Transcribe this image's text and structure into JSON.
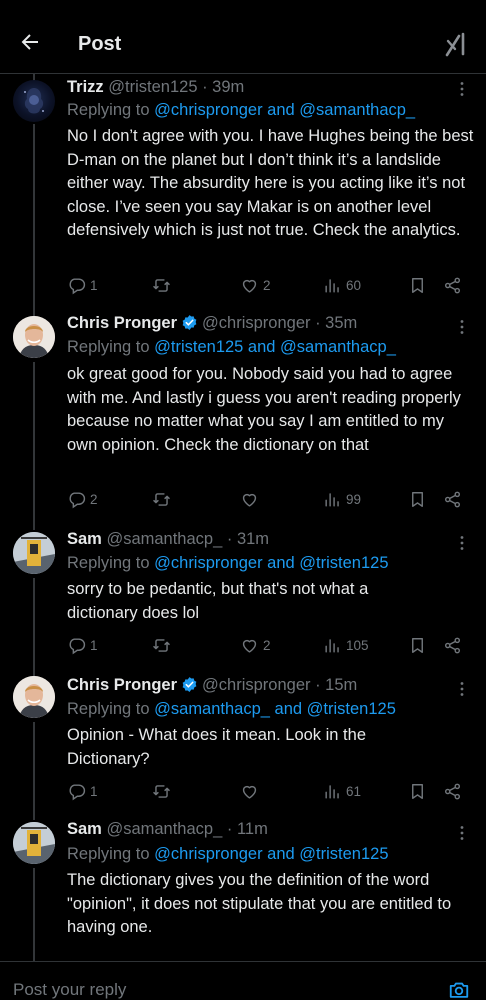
{
  "header": {
    "title": "Post"
  },
  "tweets": [
    {
      "name": "Trizz",
      "handle": "@tristen125",
      "time": "· 39m",
      "verified": false,
      "reply_prefix": "Replying to ",
      "reply_targets": "@chrispronger and @samanthacp_",
      "text": "No I don’t agree with you. I have Hughes being the best D-man on the planet but I don’t think it’s a landslide either way. The absurdity here is you acting like it’s not close. I’ve seen you say Makar is on another level defensively which is just not true. Check the analytics.",
      "replies": "1",
      "reposts": "",
      "likes": "2",
      "views": "60"
    },
    {
      "name": "Chris Pronger",
      "handle": "@chrispronger",
      "time": "· 35m",
      "verified": true,
      "reply_prefix": "Replying to ",
      "reply_targets": "@tristen125 and @samanthacp_",
      "text": "ok great good for you. Nobody said you had to agree with me. And lastly i guess you aren't reading properly because no matter what you say I am entitled to my own opinion. Check the dictionary on that",
      "replies": "2",
      "reposts": "",
      "likes": "",
      "views": "99"
    },
    {
      "name": "Sam",
      "handle": "@samanthacp_",
      "time": "· 31m",
      "verified": false,
      "reply_prefix": "Replying to ",
      "reply_targets": "@chrispronger and @tristen125",
      "text": "sorry to be pedantic, but that's not what a dictionary does lol",
      "replies": "1",
      "reposts": "",
      "likes": "2",
      "views": "105"
    },
    {
      "name": "Chris Pronger",
      "handle": "@chrispronger",
      "time": "· 15m",
      "verified": true,
      "reply_prefix": "Replying to ",
      "reply_targets": "@samanthacp_ and @tristen125",
      "text": "Opinion - What does it mean. Look in the Dictionary?",
      "replies": "1",
      "reposts": "",
      "likes": "",
      "views": "61"
    },
    {
      "name": "Sam",
      "handle": "@samanthacp_",
      "time": "· 11m",
      "verified": false,
      "reply_prefix": "Replying to ",
      "reply_targets": "@chrispronger and @tristen125",
      "text": "The dictionary gives you the definition of the word \"opinion\", it does not stipulate that you are entitled to having one.",
      "replies": "",
      "reposts": "",
      "likes": "",
      "views": ""
    }
  ],
  "composer": {
    "placeholder": "Post your reply"
  },
  "icons": {
    "back": "arrow-left-icon",
    "grok": "grok-icon",
    "more": "more-icon",
    "verified": "verified-badge-icon",
    "reply": "reply-icon",
    "repost": "repost-icon",
    "like": "heart-icon",
    "views": "views-icon",
    "bookmark": "bookmark-icon",
    "share": "share-icon",
    "camera": "camera-icon"
  },
  "colors": {
    "background": "#000000",
    "text": "#e7e9ea",
    "muted": "#71767b",
    "link": "#1d9bf0",
    "verified": "#1d9bf0",
    "divider": "#2f3336"
  }
}
